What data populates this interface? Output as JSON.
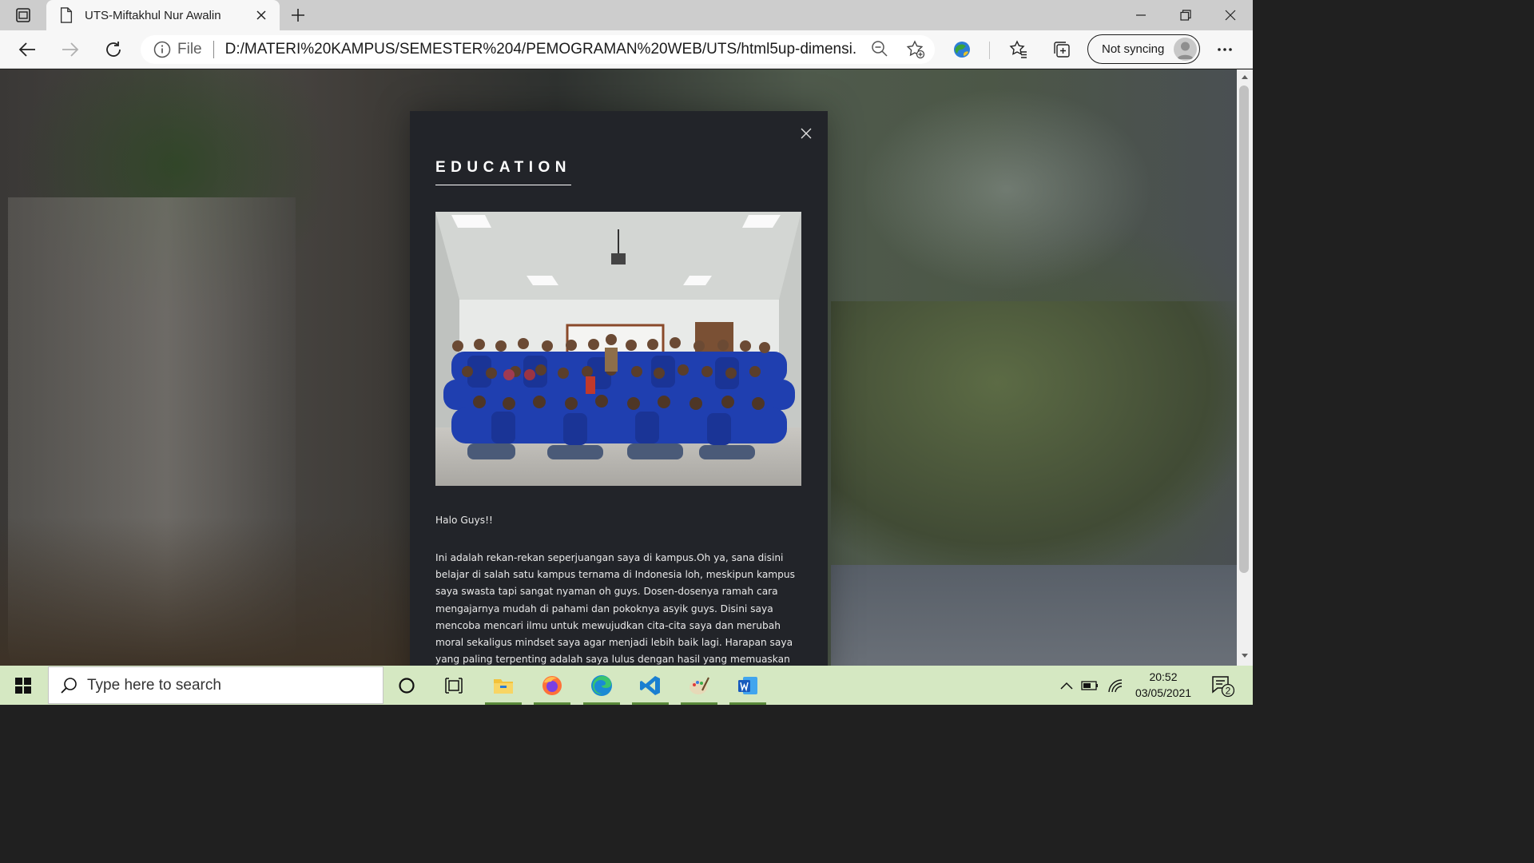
{
  "browser": {
    "tab_title": "UTS-Miftakhul Nur Awalin",
    "address_prefix": "File",
    "url": "D:/MATERI%20KAMPUS/SEMESTER%204/PEMOGRAMAN%20WEB/UTS/html5up-dimensi...",
    "sync_label": "Not syncing",
    "icons": [
      "tab-actions-icon",
      "page-icon",
      "close-icon",
      "plus-icon",
      "minimize-icon",
      "restore-icon",
      "close-icon",
      "back-icon",
      "forward-icon",
      "refresh-icon",
      "info-icon",
      "zoom-icon",
      "add-favorite-icon",
      "extension-icon",
      "favorites-icon",
      "collections-icon",
      "avatar-icon",
      "more-icon"
    ]
  },
  "modal": {
    "title": "EDUCATION",
    "greeting": "Halo Guys!!",
    "paragraph": "Ini adalah rekan-rekan seperjuangan saya di kampus.Oh ya, sana disini belajar di salah satu kampus ternama di Indonesia loh, meskipun kampus saya swasta tapi sangat nyaman oh guys. Dosen-dosenya ramah cara mengajarnya mudah di pahami dan pokoknya asyik guys. Disini saya mencoba mencari ilmu untuk mewujudkan cita-cita saya dan merubah moral sekaligus mindset saya agar menjadi lebih baik lagi. Harapan saya yang paling terpenting adalah saya lulus dengan hasil yang memuaskan dari Universitas Pelita Bangsa dan setelah saya lulus saya bisa menjadi orang yang sukses"
  },
  "taskbar": {
    "search_placeholder": "Type here to search",
    "time": "20:52",
    "date": "03/05/2021",
    "notification_count": "2",
    "apps": [
      "cortana-icon",
      "task-view-icon",
      "file-explorer-icon",
      "firefox-icon",
      "edge-icon",
      "vscode-icon",
      "paint-icon",
      "word-icon"
    ]
  },
  "colors": {
    "modal_bg": "#222429",
    "taskbar_bg": "#d5e8c2",
    "chrome_bg": "#f7f7f7"
  }
}
